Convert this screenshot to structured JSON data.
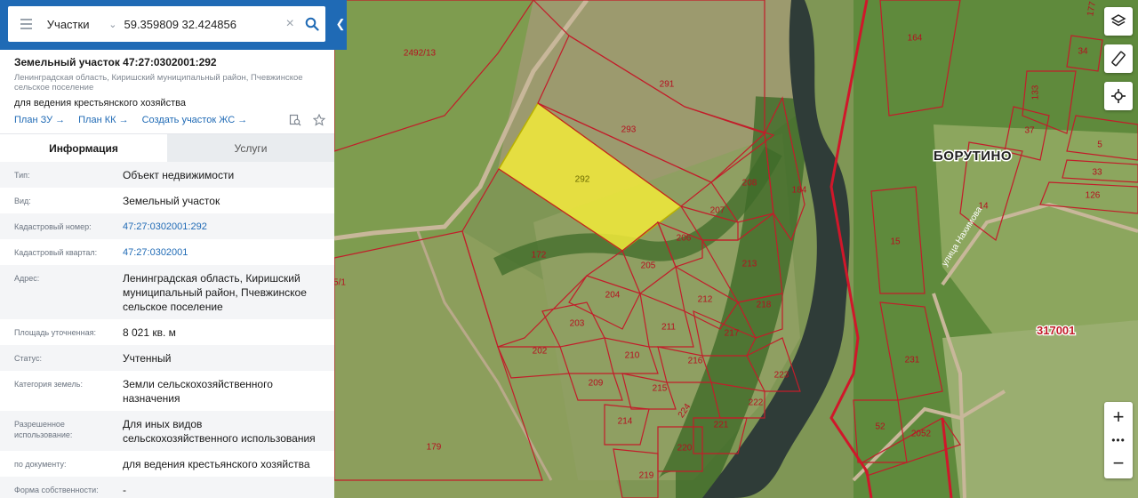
{
  "search": {
    "type_label": "Участки",
    "query": "59.359809 32.424856"
  },
  "parcel": {
    "title": "Земельный участок 47:27:0302001:292",
    "address_short": "Ленинградская область, Киришский муниципальный район, Пчевжинское сельское поселение",
    "purpose": "для ведения крестьянского хозяйства",
    "links": [
      "План ЗУ →",
      "План КК →",
      "Создать участок ЖС →"
    ]
  },
  "tabs": [
    {
      "label": "Информация",
      "active": true
    },
    {
      "label": "Услуги",
      "active": false
    }
  ],
  "details": [
    {
      "key": "Тип:",
      "value": "Объект недвижимости",
      "link": false
    },
    {
      "key": "Вид:",
      "value": "Земельный участок",
      "link": false
    },
    {
      "key": "Кадастровый номер:",
      "value": "47:27:0302001:292",
      "link": true
    },
    {
      "key": "Кадастровый квартал:",
      "value": "47:27:0302001",
      "link": true
    },
    {
      "key": "Адрес:",
      "value": "Ленинградская область, Киришский муниципальный район, Пчевжинское сельское поселение",
      "link": false
    },
    {
      "key": "Площадь уточненная:",
      "value": "8 021 кв. м",
      "link": false
    },
    {
      "key": "Статус:",
      "value": "Учтенный",
      "link": false
    },
    {
      "key": "Категория земель:",
      "value": "Земли сельскохозяйственного назначения",
      "link": false
    },
    {
      "key": "Разрешенное использование:",
      "value": "Для иных видов сельскохозяйственного использования",
      "link": false
    },
    {
      "key": "по документу:",
      "value": "для ведения крестьянского хозяйства",
      "link": false
    },
    {
      "key": "Форма собственности:",
      "value": "-",
      "link": false
    }
  ],
  "map": {
    "village": "БОРУТИНО",
    "quarter": "317001",
    "street": "улица Нахимова",
    "selected_parcel": "292",
    "parcel_labels": [
      "2492/13",
      "291",
      "293",
      "292",
      "208",
      "207",
      "206",
      "184",
      "172",
      "205",
      "213",
      "204",
      "212",
      "218",
      "203",
      "211",
      "217",
      "202",
      "210",
      "216",
      "223",
      "209",
      "215",
      "222",
      "224",
      "214",
      "221",
      "220",
      "219",
      "179",
      "231",
      "52",
      "2052",
      "164",
      "15",
      "14",
      "37",
      "5",
      "33",
      "126",
      "133",
      "34",
      "177",
      "5/1"
    ],
    "highlight_color": "#f2ea3a",
    "boundary_color": "#c21d2a"
  }
}
